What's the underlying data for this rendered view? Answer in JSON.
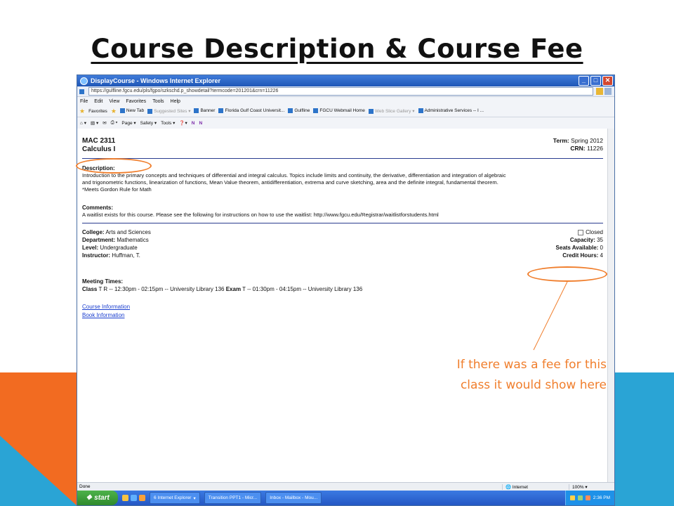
{
  "slide": {
    "title": "Course Description & Course Fee",
    "annotation": {
      "line1": "If there was a fee for this",
      "line2": "class it would show here"
    },
    "colors": {
      "accent_orange": "#f26b21",
      "accent_blue": "#2aa4d5",
      "annotation": "#f07e2c"
    }
  },
  "browser": {
    "title": "DisplayCourse - Windows Internet Explorer",
    "address": "https://gulfline.fgcu.edu/pls/fgpo/szkschd.p_showdetail?termcode=201201&crn=11226",
    "menu": [
      "File",
      "Edit",
      "View",
      "Favorites",
      "Tools",
      "Help"
    ],
    "favorites_label": "Favorites",
    "favorites": [
      "New Tab",
      "Suggested Sites ▾",
      "Banner",
      "Florida Gulf Coast Universit...",
      "Gulfline",
      "FGCU Webmail Home",
      "Web Slice Gallery ▾",
      "Administrative Services -- I ..."
    ],
    "command_bar": [
      "Page ▾",
      "Safety ▾",
      "Tools ▾"
    ],
    "status": "Done",
    "zone": "Internet",
    "zoom": "100%"
  },
  "course": {
    "code": "MAC 2311",
    "name": "Calculus I",
    "term_label": "Term:",
    "term": "Spring 2012",
    "crn_label": "CRN:",
    "crn": "11226",
    "description_label": "Description:",
    "description_lines": [
      "Introduction to the primary concepts and techniques of differential and integral calculus. Topics include limits and continuity, the derivative, differentiation and integration of algebraic",
      "and trigonometric functions, linearization of functions, Mean Value theorem, antidifferentiation, extrema and curve sketching, area and the definite integral, fundamental theorem.",
      "*Meets Gordon Rule for Math"
    ],
    "comments_label": "Comments:",
    "comments": "A waitlist exists for this course. Please see the following for instructions on how to use the waitlist: http://www.fgcu.edu/Registrar/waitlistforstudents.html",
    "college_label": "College:",
    "college": "Arts and Sciences",
    "department_label": "Department:",
    "department": "Mathematics",
    "level_label": "Level:",
    "level": "Undergraduate",
    "instructor_label": "Instructor:",
    "instructor": "Huffman, T.",
    "closed_label": "Closed",
    "capacity_label": "Capacity:",
    "capacity": "35",
    "seats_label": "Seats Available:",
    "seats": "0",
    "credit_label": "Credit Hours:",
    "credit": "4",
    "meeting_label": "Meeting Times:",
    "class_label": "Class",
    "class_time": "T R -- 12:30pm - 02:15pm -- University Library 136",
    "exam_label": "Exam",
    "exam_time": "T -- 01:30pm - 04:15pm -- University Library 136",
    "links": [
      "Course Information",
      "Book Information"
    ]
  },
  "taskbar": {
    "start": "start",
    "buttons": [
      "6 Internet Explorer",
      "Transition PPT1 - Micr...",
      "Inbox - Mailbox - Mou..."
    ],
    "clock": "2:36 PM"
  }
}
